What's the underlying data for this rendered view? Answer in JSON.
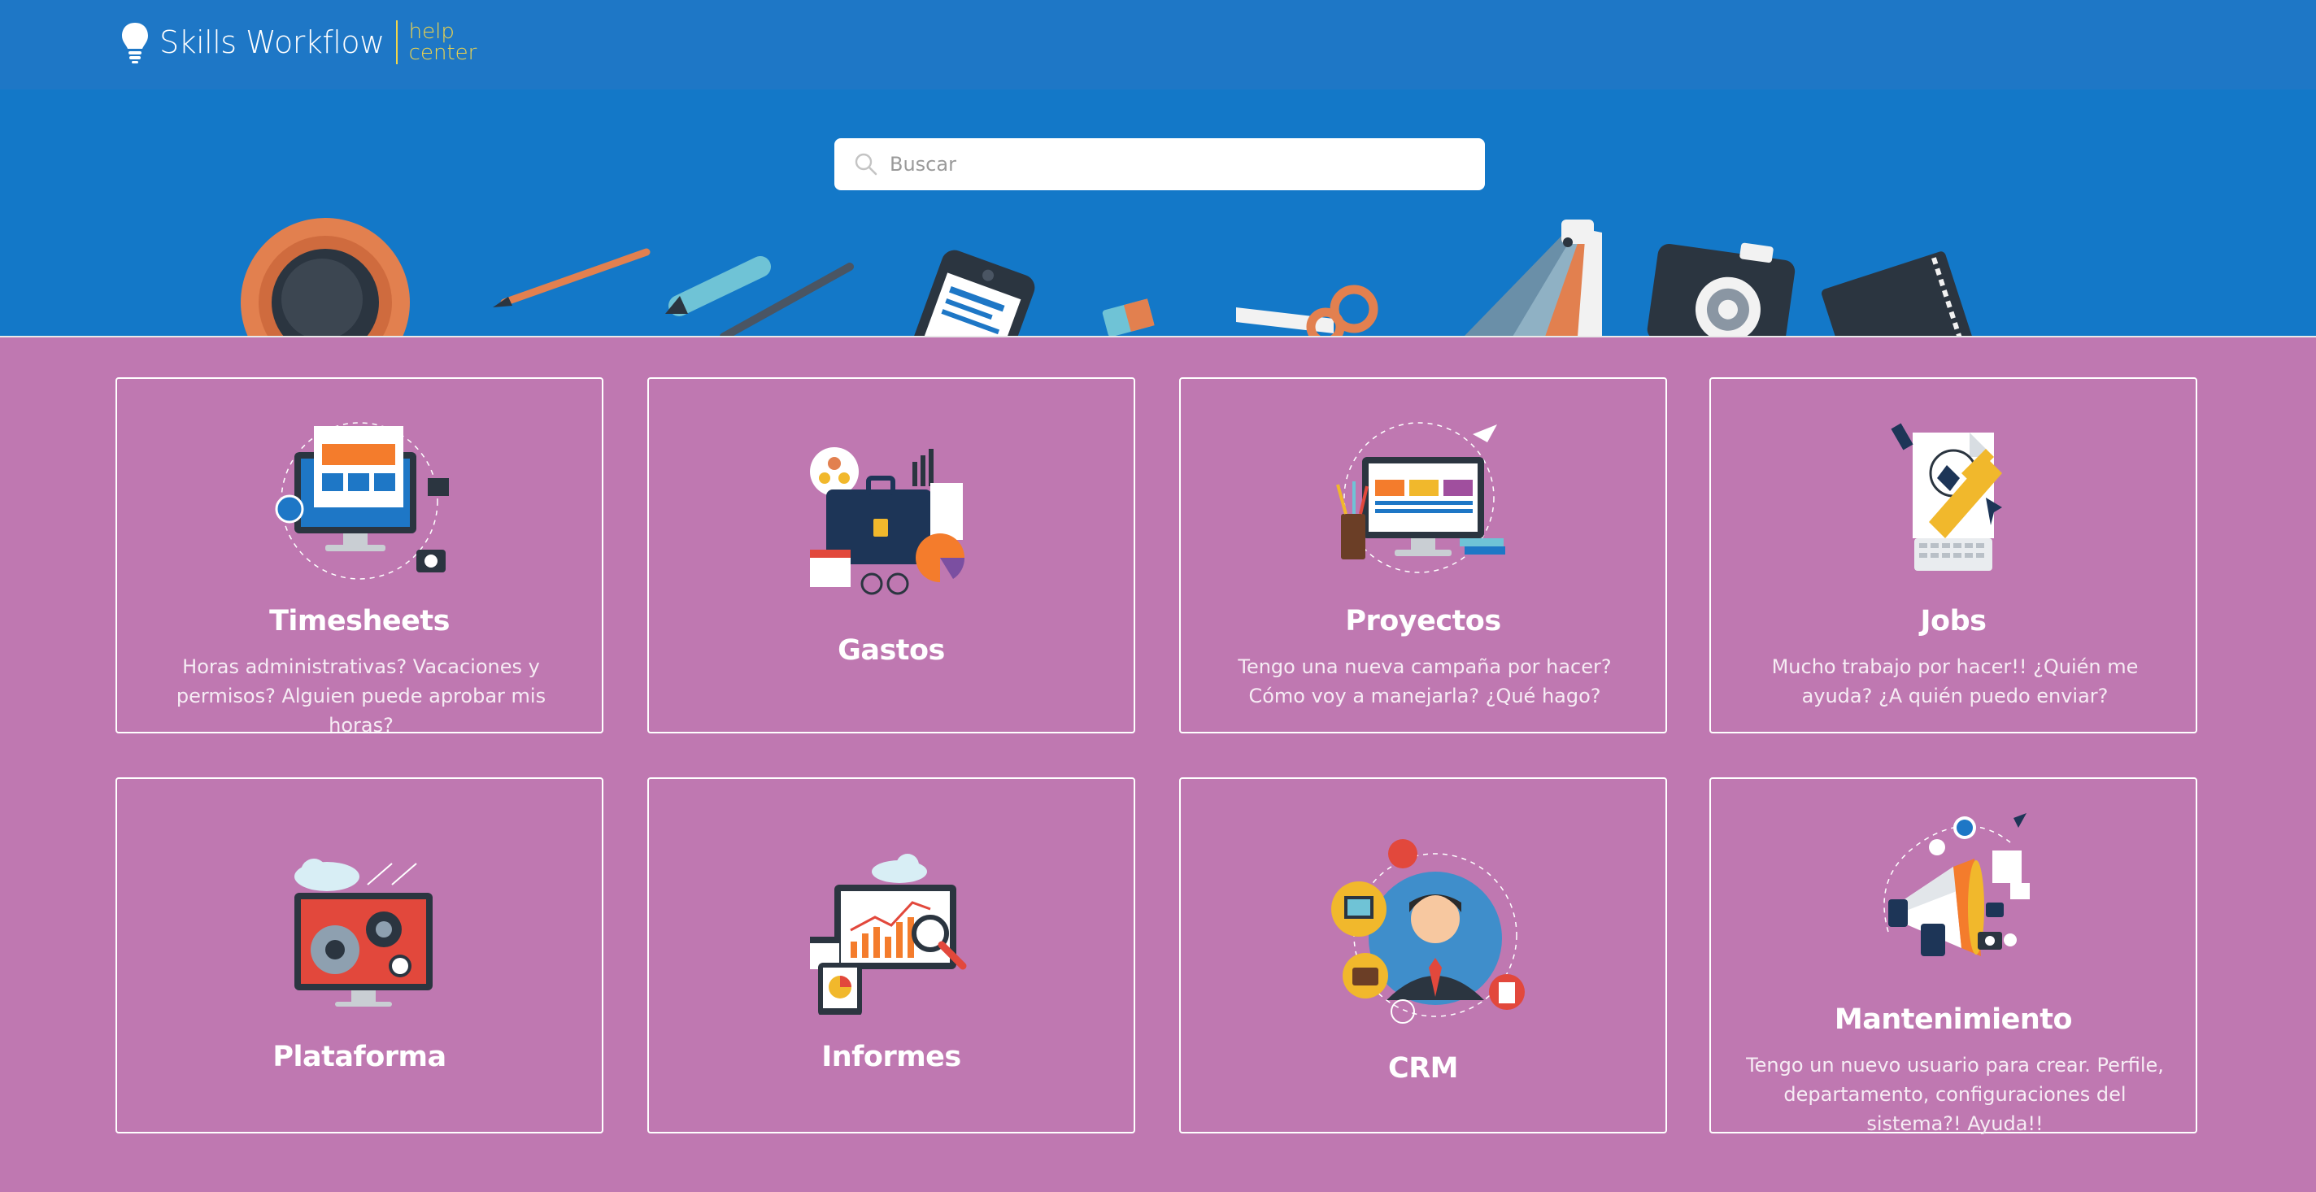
{
  "header": {
    "brand_name": "Skills Workflow",
    "brand_sub_line1": "help",
    "brand_sub_line2": "center",
    "logo_icon": "lightbulb-icon"
  },
  "search": {
    "placeholder": "Buscar",
    "value": "",
    "icon": "search-icon"
  },
  "colors": {
    "header": "#1e77c6",
    "hero": "#1378c8",
    "page_background": "#bf78b1",
    "brand_accent": "#f1d54a"
  },
  "categories": [
    {
      "title": "Timesheets",
      "description": "Horas administrativas? Vacaciones y permisos? Alguien puede aprobar mis horas?",
      "icon": "timesheet-illustration"
    },
    {
      "title": "Gastos",
      "description": "",
      "icon": "expenses-illustration"
    },
    {
      "title": "Proyectos",
      "description": "Tengo una nueva campaña por hacer? Cómo voy a manejarla? ¿Qué hago?",
      "icon": "projects-illustration"
    },
    {
      "title": "Jobs",
      "description": "Mucho trabajo por hacer!! ¿Quién me ayuda? ¿A quién puedo enviar?",
      "icon": "jobs-illustration"
    },
    {
      "title": "Plataforma",
      "description": "",
      "icon": "platform-illustration"
    },
    {
      "title": "Informes",
      "description": "",
      "icon": "reports-illustration"
    },
    {
      "title": "CRM",
      "description": "",
      "icon": "crm-illustration"
    },
    {
      "title": "Mantenimiento",
      "description": "Tengo un nuevo usuario para crear. Perfile, departamento, configuraciones del sistema?! Ayuda!!",
      "icon": "maintenance-illustration"
    }
  ]
}
